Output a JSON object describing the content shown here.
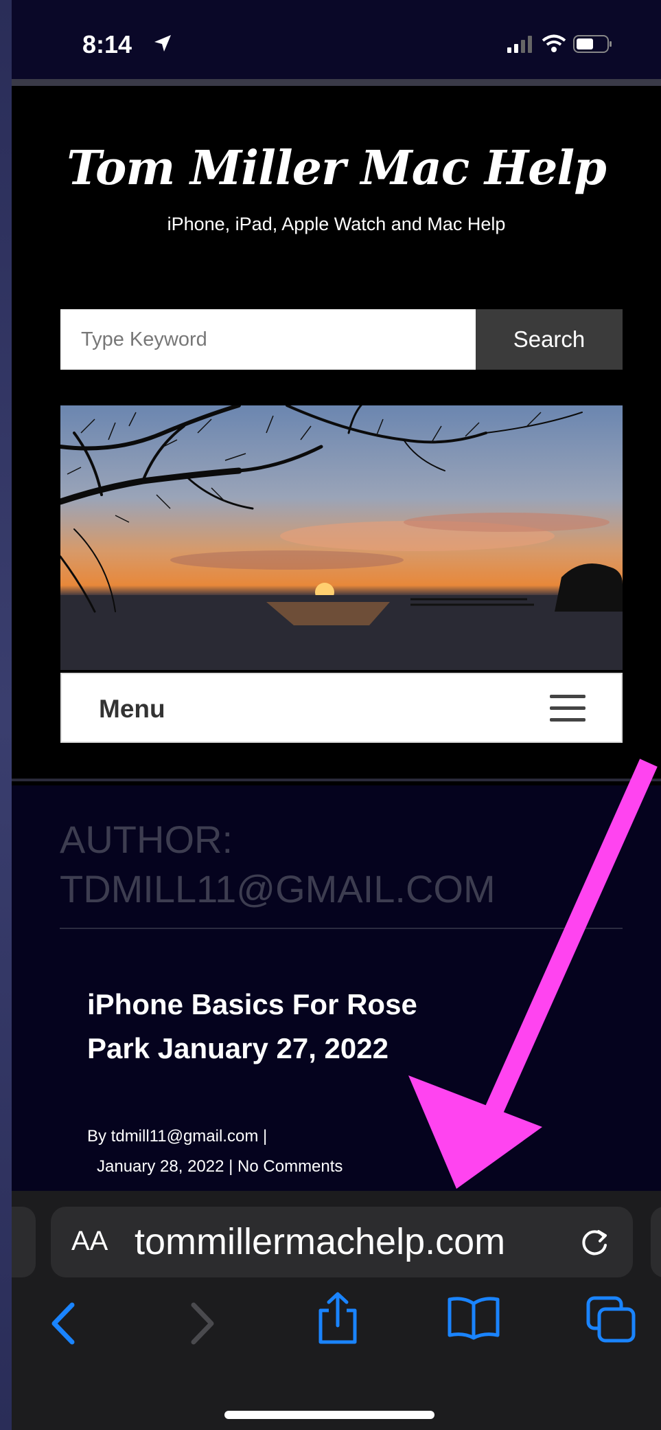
{
  "status_bar": {
    "time": "8:14"
  },
  "site": {
    "title": "Tom Miller Mac Help",
    "tagline": "iPhone, iPad, Apple Watch and Mac Help"
  },
  "search": {
    "placeholder": "Type Keyword",
    "button_label": "Search"
  },
  "menu": {
    "label": "Menu"
  },
  "archive": {
    "line1": "AUTHOR:",
    "line2": "TDMILL11@GMAIL.COM"
  },
  "post": {
    "title": "iPhone Basics For Rose Park January 27, 2022",
    "byline": "By tdmill11@gmail.com |",
    "date_comments": "January 28, 2022 | No Comments"
  },
  "browser": {
    "aa_label": "AA",
    "url": "tommillermachelp.com"
  },
  "colors": {
    "annotation_arrow": "#ff44f0",
    "toolbar_blue": "#1a84ff"
  },
  "icons": [
    "location-arrow-icon",
    "signal-icon",
    "wifi-icon",
    "battery-icon",
    "hamburger-icon",
    "reload-icon",
    "back-icon",
    "forward-icon",
    "share-icon",
    "bookmarks-icon",
    "tabs-icon"
  ]
}
